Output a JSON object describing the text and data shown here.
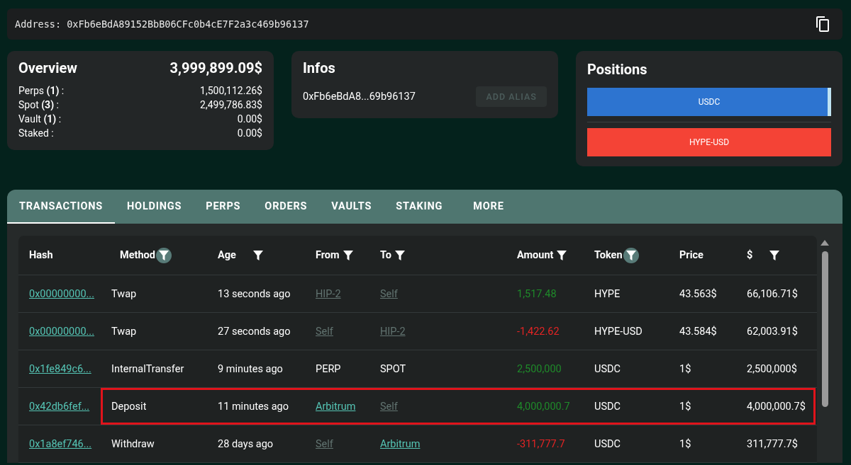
{
  "address_bar": {
    "label": "Address:",
    "value": "0xFb6eBdA89152BbB06CFc0b4cE7F2a3c469b96137"
  },
  "overview": {
    "title": "Overview",
    "total": "3,999,899.09$",
    "rows": [
      {
        "label": "Perps **(1)** :",
        "value": "1,500,112.26$"
      },
      {
        "label": "Spot **(3)** :",
        "value": "2,499,786.83$"
      },
      {
        "label": "Vault **(1)** :",
        "value": "0.00$"
      },
      {
        "label": "Staked :",
        "value": "0.00$"
      }
    ]
  },
  "infos": {
    "title": "Infos",
    "address": "0xFb6eBdA8...69b96137",
    "button": {
      "label": "ADD ALIAS",
      "disabled": true
    }
  },
  "positions": {
    "title": "Positions",
    "bars": [
      {
        "label": "USDC",
        "color": "#2d74d0",
        "level": 0.985
      },
      {
        "label": "HYPE-USD",
        "color": "#f44336",
        "level": 1
      }
    ]
  },
  "tabs": [
    {
      "label": "TRANSACTIONS",
      "selected": true
    },
    {
      "label": "HOLDINGS",
      "selected": false
    },
    {
      "label": "PERPS",
      "selected": false
    },
    {
      "label": "ORDERS",
      "selected": false
    },
    {
      "label": "VAULTS",
      "selected": false
    },
    {
      "label": "STAKING",
      "selected": false
    },
    {
      "label": "MORE",
      "selected": false
    }
  ],
  "table": {
    "columns": [
      {
        "label": "Hash",
        "filterable": false
      },
      {
        "label": "Method",
        "filterable": true,
        "filter_active": true
      },
      {
        "label": "Age",
        "filterable": true,
        "filter_active": false
      },
      {
        "label": "From",
        "filterable": true,
        "filter_active": false
      },
      {
        "label": "To",
        "filterable": true,
        "filter_active": false
      },
      {
        "label": "Amount",
        "filterable": true,
        "filter_active": false
      },
      {
        "label": "Token",
        "filterable": true,
        "filter_active": true
      },
      {
        "label": "Price",
        "filterable": false
      },
      {
        "label": "$",
        "filterable": true,
        "filter_active": false
      }
    ],
    "rows": [
      {
        "highlighted": false,
        "hash": "0x00000000...",
        "method": "Twap",
        "age": "13 seconds ago",
        "from": {
          "text": "HIP-2",
          "kind": "muted-link"
        },
        "to": {
          "text": "Self",
          "kind": "muted-link"
        },
        "amount": {
          "text": "1,517.48",
          "kind": "in"
        },
        "token": "HYPE",
        "price": "43.563$",
        "usd": "66,106.71$"
      },
      {
        "highlighted": false,
        "hash": "0x00000000...",
        "method": "Twap",
        "age": "27 seconds ago",
        "from": {
          "text": "Self",
          "kind": "muted-link"
        },
        "to": {
          "text": "HIP-2",
          "kind": "muted-link"
        },
        "amount": {
          "text": "-1,422.62",
          "kind": "out"
        },
        "token": "HYPE-USD",
        "price": "43.584$",
        "usd": "62,003.91$"
      },
      {
        "highlighted": false,
        "hash": "0x1fe849c6...",
        "method": "InternalTransfer",
        "age": "9 minutes ago",
        "from": {
          "text": "PERP",
          "kind": "plain"
        },
        "to": {
          "text": "SPOT",
          "kind": "plain"
        },
        "amount": {
          "text": "2,500,000",
          "kind": "in"
        },
        "token": "USDC",
        "price": "1$",
        "usd": "2,500,000$"
      },
      {
        "highlighted": true,
        "hash": "0x42db6fef...",
        "method": "Deposit",
        "age": "11 minutes ago",
        "from": {
          "text": "Arbitrum",
          "kind": "link"
        },
        "to": {
          "text": "Self",
          "kind": "muted-link"
        },
        "amount": {
          "text": "4,000,000.7",
          "kind": "in"
        },
        "token": "USDC",
        "price": "1$",
        "usd": "4,000,000.7$"
      },
      {
        "highlighted": false,
        "hash": "0x1a8ef746...",
        "method": "Withdraw",
        "age": "28 days ago",
        "from": {
          "text": "Self",
          "kind": "muted-link"
        },
        "to": {
          "text": "Arbitrum",
          "kind": "link"
        },
        "amount": {
          "text": "-311,777.7",
          "kind": "out"
        },
        "token": "USDC",
        "price": "1$",
        "usd": "311,777.7$"
      }
    ]
  }
}
